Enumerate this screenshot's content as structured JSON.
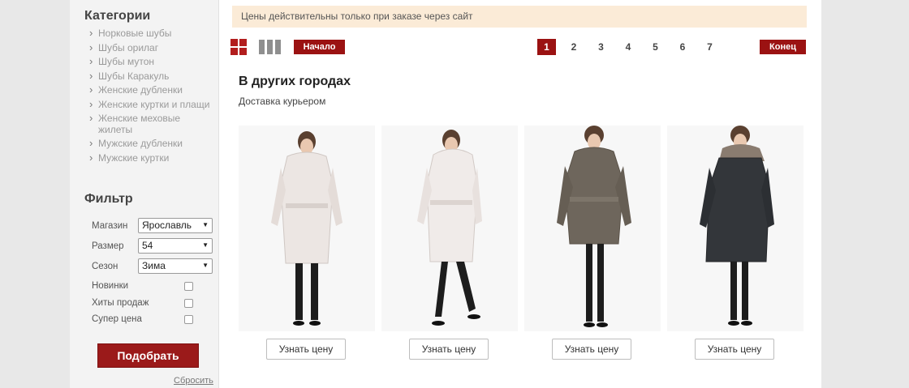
{
  "sidebar": {
    "categories_title": "Категории",
    "categories": [
      "Норковые шубы",
      "Шубы орилаг",
      "Шубы мутон",
      "Шубы Каракуль",
      "Женские дубленки",
      "Женские куртки и плащи",
      "Женские меховые жилеты",
      "Мужские дубленки",
      "Мужские куртки"
    ],
    "filter_title": "Фильтр",
    "filters": {
      "shop_label": "Магазин",
      "shop_value": "Ярославль",
      "size_label": "Размер",
      "size_value": "54",
      "season_label": "Сезон",
      "season_value": "Зима"
    },
    "checks": {
      "new_label": "Новинки",
      "hits_label": "Хиты продаж",
      "super_label": "Супер цена"
    },
    "submit_label": "Подобрать",
    "reset_label": "Сбросить"
  },
  "notice": "Цены действительны только при заказе через сайт",
  "toolbar": {
    "start_label": "Начало",
    "end_label": "Конец",
    "pages": [
      "1",
      "2",
      "3",
      "4",
      "5",
      "6",
      "7"
    ],
    "active_page": "1"
  },
  "section": {
    "title": "В других городах",
    "subtitle": "Доставка курьером"
  },
  "products": [
    {
      "coat_color": "#ece6e3",
      "button_label": "Узнать цену"
    },
    {
      "coat_color": "#f0ebe9",
      "button_label": "Узнать цену"
    },
    {
      "coat_color": "#6e665c",
      "button_label": "Узнать цену"
    },
    {
      "coat_color": "#33363a",
      "button_label": "Узнать цену"
    }
  ],
  "colors": {
    "accent": "#9b1212",
    "notice_bg": "#fbebd7"
  }
}
